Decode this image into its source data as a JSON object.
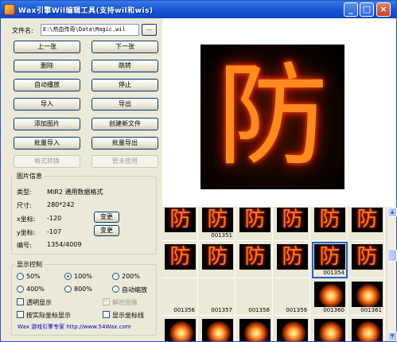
{
  "window": {
    "title": "Wax引擎Wil编辑工具(支持wil和wis)",
    "min_glyph": "_",
    "max_glyph": "□",
    "close_glyph": "×",
    "app_icon": "app-icon"
  },
  "file": {
    "label": "文件名:",
    "path": "E:\\热血传奇\\Data\\Magic.wil",
    "browse_label": "..."
  },
  "buttons": {
    "prev": "上一张",
    "next": "下一张",
    "delete": "删除",
    "jump": "跳转",
    "autoplay": "自动播放",
    "stop": "停止",
    "import": "导入",
    "export": "导出",
    "add_image": "添加图片",
    "create_file": "创建新文件",
    "batch_import": "批量导入",
    "batch_export": "批量导出",
    "format_convert": "格式转换",
    "not_used": "暂未使用"
  },
  "image_info": {
    "group_title": "图片信息",
    "type_label": "类型:",
    "type_value": "MIR2  通用数据格式",
    "size_label": "尺寸:",
    "size_value": "280*242",
    "x_label": "x坐标:",
    "x_value": "-120",
    "x_change": "变更",
    "y_label": "y坐标:",
    "y_value": "-107",
    "y_change": "变更",
    "index_label": "编号:",
    "index_value": "1354/4009"
  },
  "display": {
    "group_title": "显示控制",
    "zoom_options": [
      "50%",
      "100%",
      "200%",
      "400%",
      "800%",
      "自动缩放"
    ],
    "zoom_selected": "100%",
    "transparent": "透明显示",
    "decrypt": "解密图像",
    "actual_coords": "按实际坐标显示",
    "show_axis": "显示坐标线"
  },
  "footer": "Wax 游戏引擎专家  http://www.54Wax.com",
  "preview": {
    "glyph": "防",
    "accent": "#ff8a1e"
  },
  "thumbs": [
    {
      "n": "",
      "glyph": "防"
    },
    {
      "n": "001351",
      "glyph": "防"
    },
    {
      "n": "",
      "glyph": "防"
    },
    {
      "n": "",
      "glyph": "防"
    },
    {
      "n": "",
      "glyph": "防"
    },
    {
      "n": "",
      "glyph": "防"
    },
    {
      "n": "",
      "glyph": "防"
    },
    {
      "n": "",
      "glyph": "防"
    },
    {
      "n": "",
      "glyph": "防"
    },
    {
      "n": "",
      "glyph": "防"
    },
    {
      "n": "001354",
      "glyph": "防"
    },
    {
      "n": "",
      "glyph": "防"
    },
    {
      "n": "001356",
      "glyph": ""
    },
    {
      "n": "001357",
      "glyph": ""
    },
    {
      "n": "001358",
      "glyph": ""
    },
    {
      "n": "001359",
      "glyph": ""
    },
    {
      "n": "001360",
      "glyph": "fire"
    },
    {
      "n": "001361",
      "glyph": "fire"
    },
    {
      "n": "",
      "glyph": "fire"
    },
    {
      "n": "",
      "glyph": "fire"
    },
    {
      "n": "",
      "glyph": "fire"
    },
    {
      "n": "",
      "glyph": "fire"
    },
    {
      "n": "",
      "glyph": "fire"
    },
    {
      "n": "",
      "glyph": "fire"
    }
  ],
  "selected_thumb": "001354",
  "scrollbar": {
    "up_glyph": "▲",
    "down_glyph": "▼"
  }
}
